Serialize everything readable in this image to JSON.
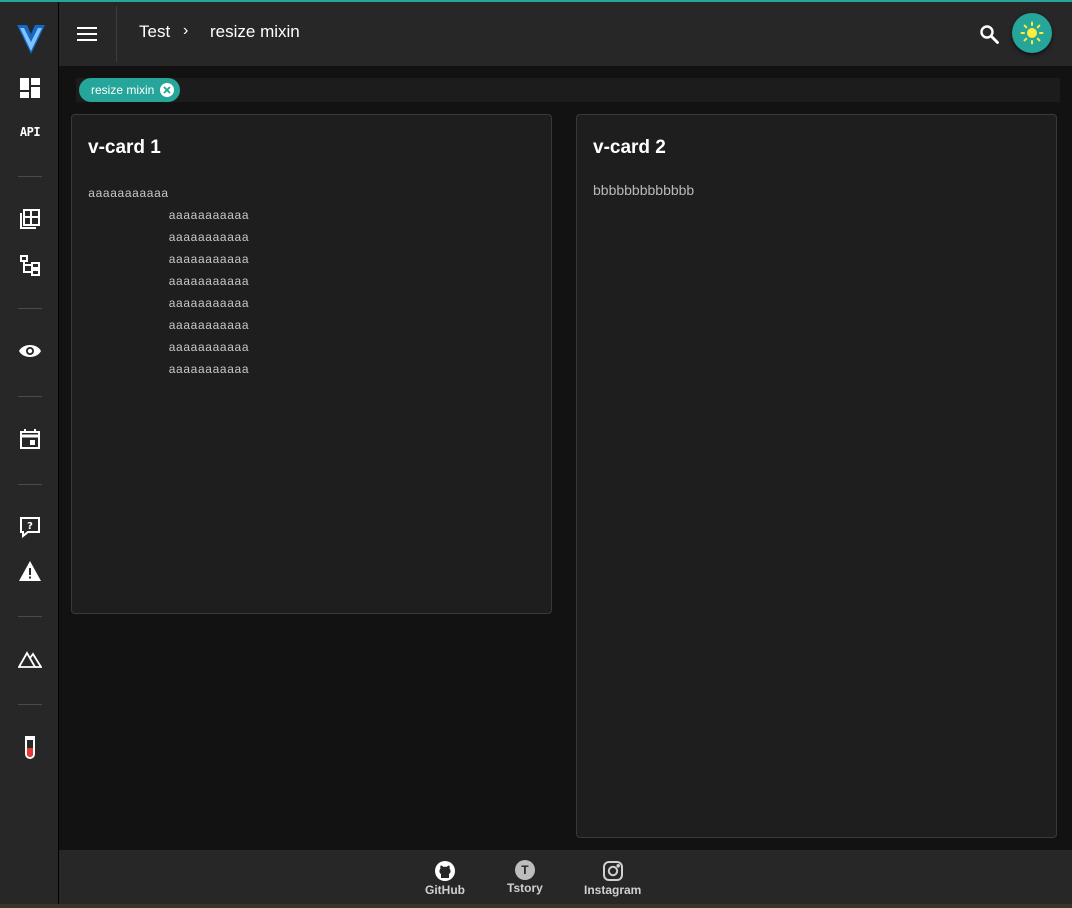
{
  "breadcrumb": {
    "parent": "Test",
    "separator": "›",
    "current": "resize mixin"
  },
  "sidebar": {
    "api_label": "API",
    "icons": [
      "dashboard-icon",
      "api-icon",
      "table-icon",
      "tree-icon",
      "eye-icon",
      "calendar-icon",
      "help-icon",
      "warning-icon",
      "mountain-icon",
      "test-tube-icon"
    ]
  },
  "tabs": [
    {
      "label": "resize mixin"
    }
  ],
  "cards": [
    {
      "title": "v-card 1",
      "content": "aaaaaaaaaaa\n           aaaaaaaaaaa\n           aaaaaaaaaaa\n           aaaaaaaaaaa\n           aaaaaaaaaaa\n           aaaaaaaaaaa\n           aaaaaaaaaaa\n           aaaaaaaaaaa\n           aaaaaaaaaaa"
    },
    {
      "title": "v-card 2",
      "content": "bbbbbbbbbbbbb"
    }
  ],
  "footer": {
    "links": [
      {
        "label": "GitHub"
      },
      {
        "label": "Tstory",
        "icon_letter": "T"
      },
      {
        "label": "Instagram"
      }
    ]
  },
  "colors": {
    "accent": "#26a69a",
    "background": "#121212",
    "surface": "#1e1e1e",
    "bar": "#272727"
  }
}
